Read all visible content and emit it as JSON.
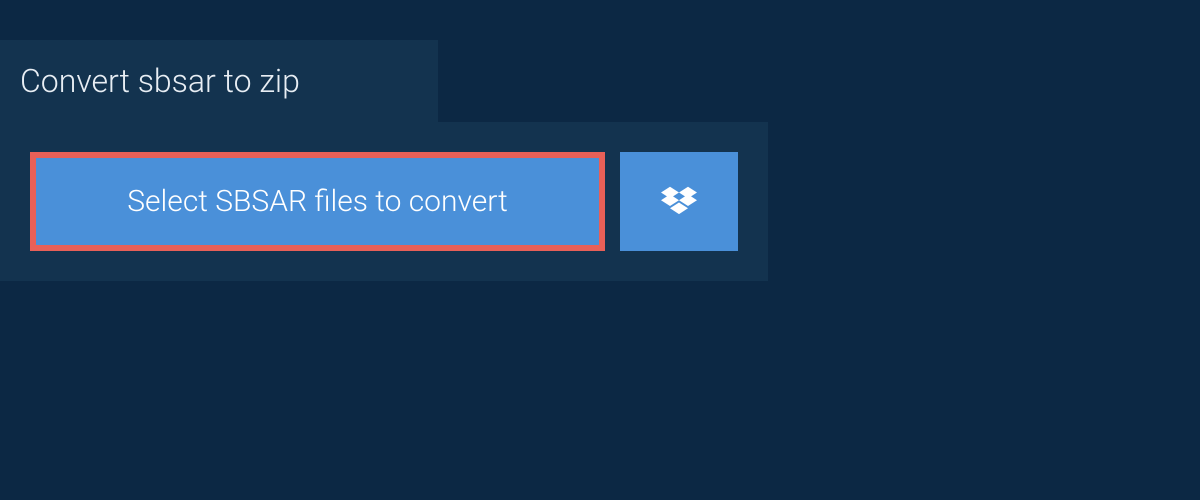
{
  "header": {
    "title": "Convert sbsar to zip"
  },
  "actions": {
    "select_label": "Select SBSAR files to convert"
  },
  "colors": {
    "background_dark": "#0c2844",
    "panel": "#13334f",
    "button_primary": "#4a90d9",
    "highlight_border": "#e86058",
    "text_light": "#e8eef4",
    "text_white": "#ffffff"
  }
}
